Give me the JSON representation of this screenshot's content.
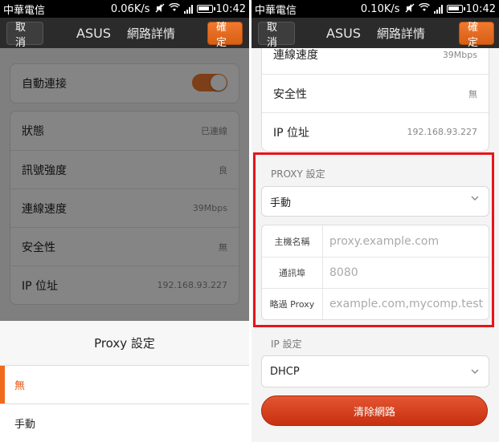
{
  "left": {
    "status": {
      "carrier": "中華電信",
      "speed": "0.06K/s",
      "time": "10:42"
    },
    "titlebar": {
      "cancel": "取消",
      "ssid": "ASUS",
      "title": "網路詳情",
      "confirm": "確定"
    },
    "auto_connect": {
      "label": "自動連接",
      "on": true
    },
    "details": [
      {
        "label": "狀態",
        "value": "已連線"
      },
      {
        "label": "訊號強度",
        "value": "良"
      },
      {
        "label": "連線速度",
        "value": "39Mbps"
      },
      {
        "label": "安全性",
        "value": "無"
      },
      {
        "label": "IP 位址",
        "value": "192.168.93.227"
      }
    ],
    "sheet": {
      "title": "Proxy 設定",
      "options": [
        {
          "label": "無",
          "selected": true
        },
        {
          "label": "手動",
          "selected": false
        }
      ]
    }
  },
  "right": {
    "status": {
      "carrier": "中華電信",
      "speed": "0.10K/s",
      "time": "10:42"
    },
    "titlebar": {
      "cancel": "取消",
      "ssid": "ASUS",
      "title": "網路詳情",
      "confirm": "確定"
    },
    "details": [
      {
        "label": "連線速度",
        "value": "39Mbps"
      },
      {
        "label": "安全性",
        "value": "無"
      },
      {
        "label": "IP 位址",
        "value": "192.168.93.227"
      }
    ],
    "proxy": {
      "section_label": "PROXY 設定",
      "selected": "手動",
      "fields": [
        {
          "label": "主機名稱",
          "placeholder": "proxy.example.com"
        },
        {
          "label": "通訊埠",
          "placeholder": "8080"
        },
        {
          "label": "略過 Proxy",
          "placeholder": "example.com,mycomp.test"
        }
      ]
    },
    "ip": {
      "section_label": "IP 設定",
      "selected": "DHCP"
    },
    "clear_button": "清除網路"
  },
  "colors": {
    "accent": "#ef7a2c",
    "highlight": "#e8141b",
    "clear_button": "#d3401f"
  },
  "icons": [
    "mute-icon",
    "wifi-icon",
    "signal-icon",
    "battery-icon",
    "chevron-down-icon"
  ]
}
